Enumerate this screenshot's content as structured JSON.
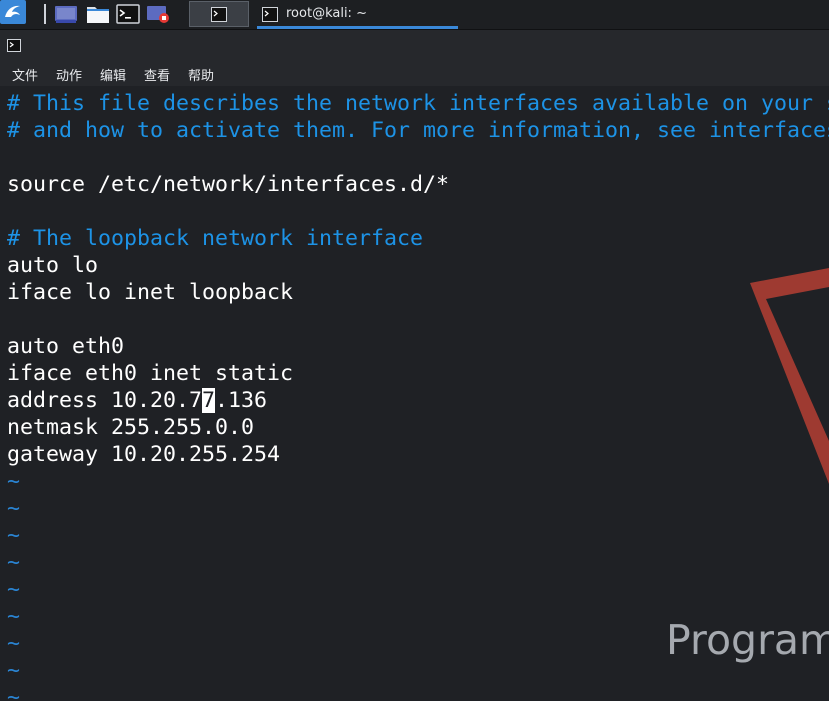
{
  "taskbar": {
    "launcher_icon": "kali-dragon-icon",
    "quick_launch": [
      {
        "name": "desktop-icon"
      },
      {
        "name": "file-manager-icon"
      },
      {
        "name": "terminal-icon"
      },
      {
        "name": "screen-recorder-icon"
      }
    ],
    "active_window_title": "root@kali: ~",
    "accent_color": "#3a88d8"
  },
  "menu": {
    "items": [
      "文件",
      "动作",
      "编辑",
      "查看",
      "帮助"
    ]
  },
  "editor": {
    "lines": [
      {
        "text": "# This file describes the network interfaces available on your s",
        "kind": "comment"
      },
      {
        "text": "# and how to activate them. For more information, see interfaces",
        "kind": "comment"
      },
      {
        "text": "",
        "kind": "plain"
      },
      {
        "text": "source /etc/network/interfaces.d/*",
        "kind": "plain"
      },
      {
        "text": "",
        "kind": "plain"
      },
      {
        "text": "# The loopback network interface",
        "kind": "comment"
      },
      {
        "text": "auto lo",
        "kind": "plain"
      },
      {
        "text": "iface lo inet loopback",
        "kind": "plain"
      },
      {
        "text": "",
        "kind": "plain"
      },
      {
        "text": "auto eth0",
        "kind": "plain"
      },
      {
        "text": "iface eth0 inet static",
        "kind": "plain"
      },
      {
        "text": "address 10.20.77.136",
        "kind": "cursor",
        "before": "address 10.20.7",
        "cursor_char": "7",
        "after": ".136"
      },
      {
        "text": "netmask 255.255.0.0",
        "kind": "plain"
      },
      {
        "text": "gateway 10.20.255.254",
        "kind": "plain"
      },
      {
        "text": "~",
        "kind": "tilde"
      },
      {
        "text": "~",
        "kind": "tilde"
      },
      {
        "text": "~",
        "kind": "tilde"
      },
      {
        "text": "~",
        "kind": "tilde"
      },
      {
        "text": "~",
        "kind": "tilde"
      },
      {
        "text": "~",
        "kind": "tilde"
      },
      {
        "text": "~",
        "kind": "tilde"
      },
      {
        "text": "~",
        "kind": "tilde"
      },
      {
        "text": "~",
        "kind": "tilde"
      }
    ],
    "comment_color": "#1d93e6",
    "text_color": "#ffffff",
    "background_color": "#1f2125"
  },
  "wallpaper": {
    "watermark_text": "Program"
  }
}
